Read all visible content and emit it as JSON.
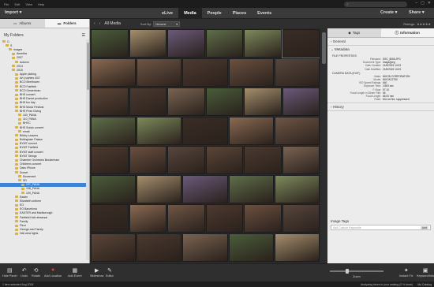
{
  "menu": [
    "File",
    "Edit",
    "View",
    "Help"
  ],
  "search": {
    "icon": "search-icon"
  },
  "window_controls": [
    "–",
    "▢",
    "✕"
  ],
  "toolbar": {
    "import_label": "Import",
    "tabs": [
      "eLive",
      "Media",
      "People",
      "Places",
      "Events"
    ],
    "active_tab": "Media",
    "create_label": "Create",
    "share_label": "Share"
  },
  "left_panel": {
    "tabs": [
      "Albums",
      "Folders"
    ],
    "active_tab": "Folders",
    "heading": "My Folders",
    "tree": [
      {
        "label": "C:",
        "depth": 0
      },
      {
        "label": "S",
        "depth": 1
      },
      {
        "label": "images",
        "depth": 2
      },
      {
        "label": "Amerika",
        "depth": 3
      },
      {
        "label": "2007",
        "depth": 3
      },
      {
        "label": "Autumn",
        "depth": 4
      },
      {
        "label": "2014",
        "depth": 3
      },
      {
        "label": "2015",
        "depth": 3
      },
      {
        "label": "Apple picking",
        "depth": 4
      },
      {
        "label": "Art (ruphies 4/07",
        "depth": 4
      },
      {
        "label": "BCO Beethoven",
        "depth": 4
      },
      {
        "label": "BCO Fairfield",
        "depth": 4
      },
      {
        "label": "BCO Gewerboko",
        "depth": 4
      },
      {
        "label": "BHS concert",
        "depth": 4
      },
      {
        "label": "BHS Dance production",
        "depth": 4
      },
      {
        "label": "BHS fun day",
        "depth": 4
      },
      {
        "label": "BHS Music Festival",
        "depth": 4
      },
      {
        "label": "BHS Prize Giving",
        "depth": 4
      },
      {
        "label": "100_PANA",
        "depth": 5
      },
      {
        "label": "110_PANA",
        "depth": 5
      },
      {
        "label": "BHVC",
        "depth": 5
      },
      {
        "label": "BHS Suisto concert",
        "depth": 4
      },
      {
        "label": "email",
        "depth": 5
      },
      {
        "label": "Birkby Leavers",
        "depth": 4
      },
      {
        "label": "Bollingham Palace",
        "depth": 4
      },
      {
        "label": "BYMT concert",
        "depth": 4
      },
      {
        "label": "BYMT Fairfield",
        "depth": 4
      },
      {
        "label": "BYMT staff concert",
        "depth": 4
      },
      {
        "label": "BYMT Strings",
        "depth": 4
      },
      {
        "label": "Chamber Orchestra Beckenham",
        "depth": 4
      },
      {
        "label": "Childrens concert",
        "depth": 4
      },
      {
        "label": "Daks iPhone",
        "depth": 4
      },
      {
        "label": "Dorset",
        "depth": 4
      },
      {
        "label": "Movement",
        "depth": 5
      },
      {
        "label": "SD",
        "depth": 5
      },
      {
        "label": "107_PANA",
        "depth": 6,
        "selected": true
      },
      {
        "label": "108_PANA",
        "depth": 6
      },
      {
        "label": "109_PANA",
        "depth": 6
      },
      {
        "label": "Easter",
        "depth": 4
      },
      {
        "label": "Elizabeth uniform",
        "depth": 4
      },
      {
        "label": "EO",
        "depth": 4
      },
      {
        "label": "EO Barcelona",
        "depth": 4
      },
      {
        "label": "EASTER and Marlborough",
        "depth": 4
      },
      {
        "label": "Fairfield Hall rehearsal",
        "depth": 4
      },
      {
        "label": "Family",
        "depth": 4
      },
      {
        "label": "Fleur",
        "depth": 4
      },
      {
        "label": "George and Family",
        "depth": 4
      },
      {
        "label": "Hall west lights",
        "depth": 4
      }
    ]
  },
  "content_bar": {
    "back_icon": "back-arrow-icon",
    "forward_icon": "forward-arrow-icon",
    "all_media_label": "All Media",
    "sort_label": "Sort By:",
    "sort_value": "Newest"
  },
  "photos": [
    {
      "color": "#4a5d3a"
    },
    {
      "color": "#a58f6d"
    },
    {
      "color": "#6b5a7a"
    },
    {
      "color": "#5f6e4a"
    },
    {
      "color": "#7d8a5c"
    },
    {
      "color": "#3a2d26"
    },
    {
      "color": "#8a6a52"
    },
    {
      "color": "#6f5646"
    },
    {
      "color": "#4d3a30"
    },
    {
      "color": "#6b5040"
    },
    {
      "color": "#57463d"
    },
    {
      "color": "#5b4638"
    },
    {
      "color": "#4b3a30"
    },
    {
      "color": "#7a6452"
    }
  ],
  "right_panel": {
    "ratings_label": "Ratings:",
    "stars": "★★★★★",
    "tabs": [
      "Tags",
      "Information"
    ],
    "active_tab": "Information",
    "general_label": "General",
    "metadata_label": "Metadata",
    "file_props_label": "FILE PROPERTIES",
    "file_props": [
      {
        "k": "Filename:",
        "v": "DSC_8055.JPG"
      },
      {
        "k": "Document Type:",
        "v": "image/jpeg"
      },
      {
        "k": "Date Created:",
        "v": "21/8/2015 14:03"
      },
      {
        "k": "Date Modified:",
        "v": "21/8/2015 14:03"
      }
    ],
    "camera_label": "CAMERA DATA (EXIF)",
    "camera": [
      {
        "k": "Make:",
        "v": "NIKON CORPORATION"
      },
      {
        "k": "Model:",
        "v": "NIKON D750"
      },
      {
        "k": "ISO Speed Ratings:",
        "v": "640"
      },
      {
        "k": "Exposure Time:",
        "v": "1/500 sec"
      },
      {
        "k": "F-Stop:",
        "v": "f/7.10"
      },
      {
        "k": "Focal Length in 35mm Film:",
        "v": "66"
      },
      {
        "k": "Focal Length:",
        "v": "66.00 mm"
      },
      {
        "k": "Flash:",
        "v": "Did not fire, suppressed"
      }
    ],
    "history_label": "History",
    "image_tags_label": "Image Tags",
    "tags_placeholder": "Add Custom Keywords",
    "add_label": "Add"
  },
  "bottom_toolbar": {
    "buttons": [
      {
        "label": "Hide Panel",
        "icon": "hide-panel-icon",
        "glyph": "▤"
      },
      {
        "label": "Undo",
        "icon": "undo-icon",
        "glyph": "↶"
      },
      {
        "label": "Rotate",
        "icon": "rotate-icon",
        "glyph": "⟲"
      },
      {
        "label": "Add Location",
        "icon": "location-pin-icon",
        "glyph": "●"
      },
      {
        "label": "Add Event",
        "icon": "calendar-icon",
        "glyph": "▦"
      },
      {
        "label": "Slideshow",
        "icon": "play-icon",
        "glyph": "▶"
      },
      {
        "label": "Editor",
        "icon": "editor-icon",
        "glyph": "✎"
      },
      {
        "label": "Instant Fix",
        "icon": "instant-fix-icon",
        "glyph": "✦"
      },
      {
        "label": "Keyword/Info",
        "icon": "keyword-info-icon",
        "glyph": "▣"
      }
    ],
    "zoom_label": "Zoom"
  },
  "status": {
    "left": "1 item selected  Aug 2015",
    "analyzing": "Analyzing faces in your catalog (0 % done)",
    "catalog": "My Catalog"
  }
}
